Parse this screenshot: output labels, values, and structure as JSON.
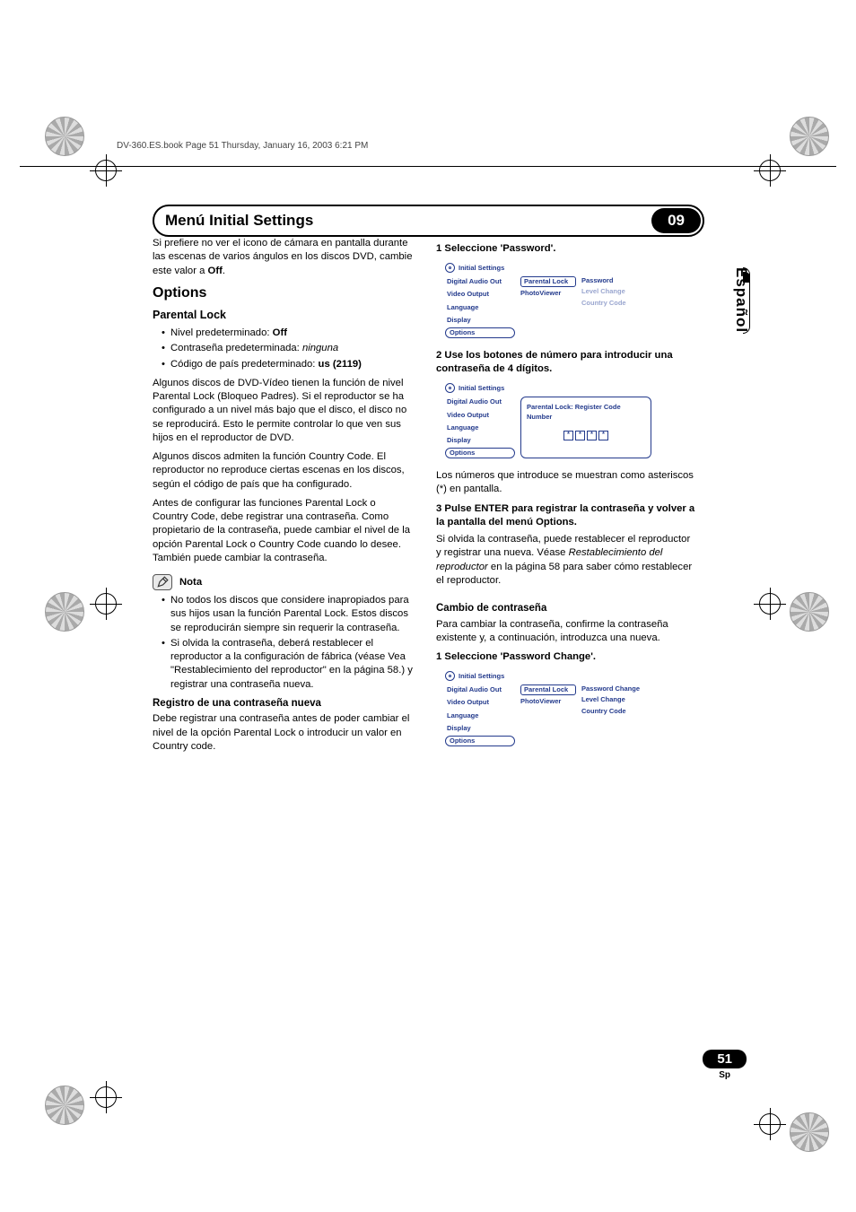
{
  "header_runner": "DV-360.ES.book  Page 51  Thursday, January 16, 2003  6:21 PM",
  "chapter": {
    "title": "Menú Initial Settings",
    "number": "09"
  },
  "side_lang": "Español",
  "page_number": "51",
  "page_lang_code": "Sp",
  "left": {
    "intro_p1a": "Si prefiere no ver el icono de cámara en pantalla durante las escenas de varios ángulos en los discos DVD, cambie este valor a ",
    "intro_off": "Off",
    "intro_p1b": ".",
    "h_options": "Options",
    "h_parental": "Parental Lock",
    "bul1a": "Nivel predeterminado: ",
    "bul1b": "Off",
    "bul2a": "Contraseña predeterminada: ",
    "bul2b": "ninguna",
    "bul3a": "Código de país predeterminado: ",
    "bul3b": "us (2119)",
    "p_par1": "Algunos discos de DVD-Vídeo tienen la función de nivel Parental Lock (Bloqueo Padres). Si el reproductor se ha configurado a un nivel más bajo que el disco, el disco no se reproducirá. Esto le permite controlar lo que ven sus hijos en el reproductor de DVD.",
    "p_par2": "Algunos discos admiten la función Country Code. El reproductor no reproduce ciertas escenas en los discos, según el código de país que ha configurado.",
    "p_par3": "Antes de configurar las funciones Parental Lock o Country Code, debe registrar una contraseña. Como propietario de la contraseña, puede cambiar el nivel de la opción Parental Lock o Country Code cuando lo desee. También puede cambiar la contraseña.",
    "note_label": "Nota",
    "note_b1": "No todos los discos que considere inapropiados para sus hijos usan la función Parental Lock. Estos discos se reproducirán siempre sin requerir la contraseña.",
    "note_b2": "Si olvida la contraseña, deberá restablecer el reproductor a la configuración de fábrica (véase Vea \"Restablecimiento del reproductor\" en la página 58.) y registrar una contraseña nueva.",
    "h_reg": "Registro de una contraseña nueva",
    "p_reg": "Debe registrar una contraseña antes de poder cambiar el nivel de la opción Parental Lock o introducir un valor en Country code."
  },
  "right": {
    "step1": "1   Seleccione 'Password'.",
    "step2": "2   Use los botones de número para introducir una contraseña de 4 dígitos.",
    "p_ast": "Los números que introduce se muestran como asteriscos (*) en pantalla.",
    "step3": "3   Pulse ENTER para registrar la contraseña y volver a la pantalla del menú Options.",
    "p_forgot_a": "Si olvida la contraseña, puede restablecer el reproductor y registrar una nueva. Véase ",
    "p_forgot_i": "Restablecimiento del reproductor",
    "p_forgot_b": " en la página 58 para saber cómo restablecer el reproductor.",
    "h_change": "Cambio de contraseña",
    "p_change": "Para cambiar la contraseña, confirme la contraseña existente y, a continuación, introduzca una nueva.",
    "step1b": "1   Seleccione 'Password Change'."
  },
  "osd": {
    "title": "Initial Settings",
    "left_items": [
      "Digital Audio Out",
      "Video Output",
      "Language",
      "Display",
      "Options"
    ],
    "mid_items": [
      "Parental Lock",
      "PhotoViewer"
    ],
    "screen1_right": [
      "Password",
      "Level Change",
      "Country Code"
    ],
    "screen2_box_title": "Parental Lock: Register Code Number",
    "screen2_code": [
      "*",
      "*",
      "*",
      "*"
    ],
    "screen3_right": [
      "Password Change",
      "Level Change",
      "Country Code"
    ]
  }
}
